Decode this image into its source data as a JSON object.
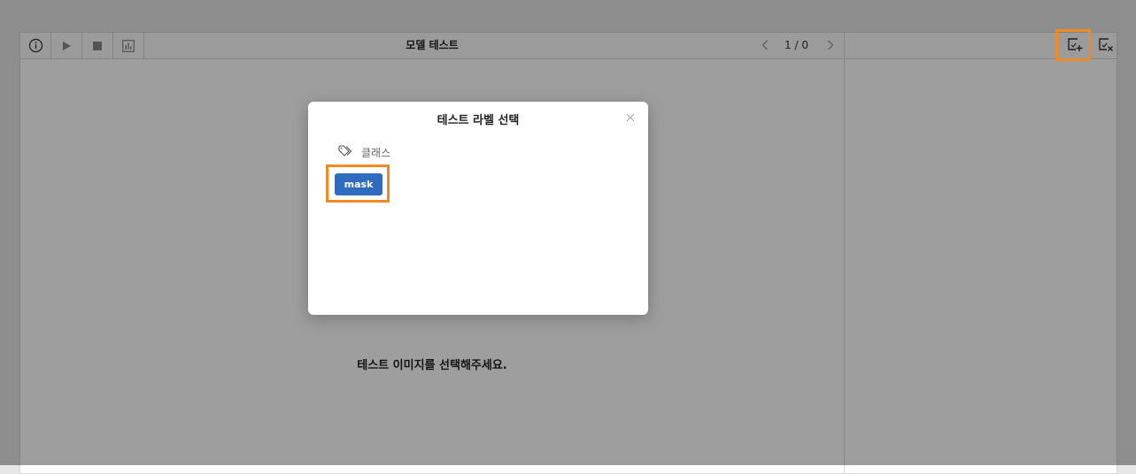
{
  "toolbar": {
    "title": "모델 테스트",
    "pager": "1 / 0",
    "icons": [
      "info-icon",
      "play-icon",
      "stop-icon",
      "chart-icon",
      "chevron-left-icon",
      "chevron-right-icon"
    ]
  },
  "main": {
    "empty_message": "테스트 이미지를 선택해주세요."
  },
  "side_toolbar": {
    "icons": [
      "image-add-icon",
      "image-remove-icon"
    ]
  },
  "modal": {
    "title": "테스트 라벨 선택",
    "class_label": "클래스",
    "labels": [
      "mask"
    ]
  },
  "colors": {
    "accent": "#2f6bbf",
    "highlight": "#f08a24",
    "overlay": "rgba(0,0,0,0.38)"
  }
}
